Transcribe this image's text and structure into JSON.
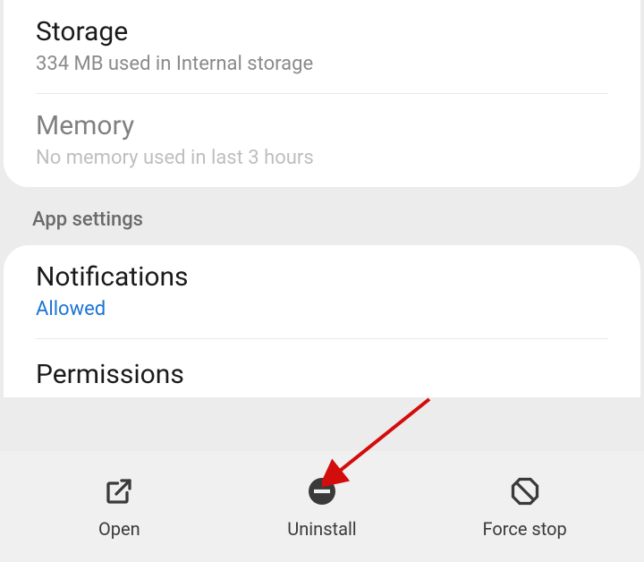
{
  "usage": {
    "storage": {
      "title": "Storage",
      "subtitle": "334 MB used in Internal storage"
    },
    "memory": {
      "title": "Memory",
      "subtitle": "No memory used in last 3 hours"
    }
  },
  "sections": {
    "app_settings": "App settings"
  },
  "settings": {
    "notifications": {
      "title": "Notifications",
      "status": "Allowed"
    },
    "permissions": {
      "title": "Permissions"
    }
  },
  "actions": {
    "open": "Open",
    "uninstall": "Uninstall",
    "force_stop": "Force stop"
  },
  "colors": {
    "link": "#1b73d4",
    "arrow": "#d30c0c"
  }
}
